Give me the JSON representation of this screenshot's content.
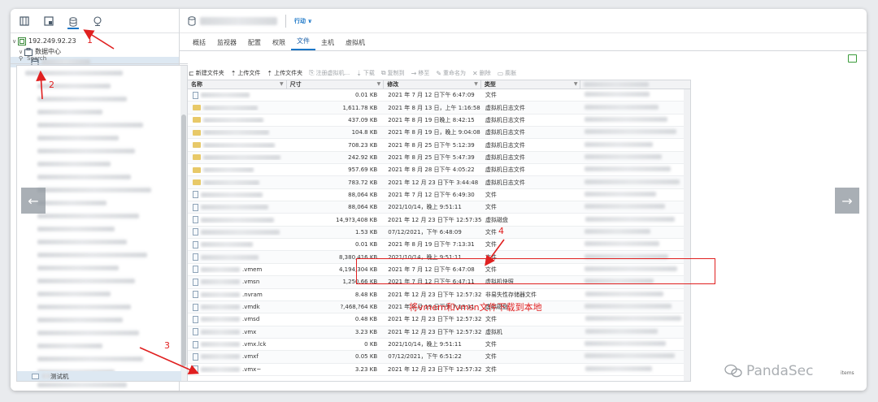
{
  "sidebar": {
    "tree": {
      "host": "192.249.92.23",
      "datacenter": "数据中心"
    }
  },
  "header": {
    "actions_label": "行动 ∨"
  },
  "tabs": [
    {
      "label": "概括"
    },
    {
      "label": "监视器"
    },
    {
      "label": "配置"
    },
    {
      "label": "权限"
    },
    {
      "label": "文件",
      "active": true
    },
    {
      "label": "主机"
    },
    {
      "label": "虚拟机"
    }
  ],
  "search": {
    "placeholder": "Search"
  },
  "folder_pane": {
    "selected_label": "测试机"
  },
  "toolbar": {
    "new_folder": "新建文件夹",
    "upload_file": "上传文件",
    "upload_folder": "上传文件夹",
    "register_vm": "注册虚拟机...",
    "download": "下载",
    "copy_to": "复制到",
    "move_to": "移至",
    "rename": "重命名为",
    "delete": "删除",
    "inflate": "膨胀"
  },
  "table": {
    "columns": [
      "名称",
      "尺寸",
      "修改",
      "类型"
    ],
    "rows": [
      {
        "name": "",
        "size": "0.01 KB",
        "modified": "2021 年 7 月 12 日下午 6:47:09",
        "type": "文件"
      },
      {
        "name": "",
        "size": "1,611.78 KB",
        "modified": "2021 年 8 月 13 日，上午 1:16:58",
        "type": "虚拟机日志文件"
      },
      {
        "name": "",
        "size": "437.09 KB",
        "modified": "2021 年 8 月 19 日晚上 8:42:15",
        "type": "虚拟机日志文件"
      },
      {
        "name": "",
        "size": "104.8 KB",
        "modified": "2021 年 8 月 19 日，晚上 9:04:08",
        "type": "虚拟机日志文件"
      },
      {
        "name": "",
        "size": "708.23 KB",
        "modified": "2021 年 8 月 25 日下午 5:12:39",
        "type": "虚拟机日志文件"
      },
      {
        "name": "",
        "size": "242.92 KB",
        "modified": "2021 年 8 月 25 日下午 5:47:39",
        "type": "虚拟机日志文件"
      },
      {
        "name": "",
        "size": "957.69 KB",
        "modified": "2021 年 8 月 28 日下午 4:05:22",
        "type": "虚拟机日志文件"
      },
      {
        "name": "",
        "size": "783.72 KB",
        "modified": "2021 年 12 月 23 日下午 3:44:48",
        "type": "虚拟机日志文件"
      },
      {
        "name": "",
        "size": "88,064 KB",
        "modified": "2021 年 7 月 12 日下午 6:49:30",
        "type": "文件"
      },
      {
        "name": "",
        "size": "88,064 KB",
        "modified": "2021/10/14，晚上 9:51:11",
        "type": "文件"
      },
      {
        "name": "",
        "size": "14,9?3,408 KB",
        "modified": "2021 年 12 月 23 日下午 12:57:35",
        "type": "虚拟磁盘"
      },
      {
        "name": "",
        "size": "1.53 KB",
        "modified": "07/12/2021，下午 6:48:09",
        "type": "文件"
      },
      {
        "name": "",
        "size": "0.01 KB",
        "modified": "2021 年 8 月 19 日下午 7:13:31",
        "type": "文件"
      },
      {
        "name": "",
        "size": "8,380,416 KB",
        "modified": "2021/10/14，晚上 9:51:11",
        "type": "文件"
      },
      {
        "name": ".vmem",
        "size": "4,194,304 KB",
        "modified": "2021 年 7 月 12 日下午 6:47:08",
        "type": "文件"
      },
      {
        "name": ".vmsn",
        "size": "1,250.66 KB",
        "modified": "2021 年 7 月 12 日下午 6:47:11",
        "type": "虚拟机快照"
      },
      {
        "name": ".nvram",
        "size": "8.48 KB",
        "modified": "2021 年 12 月 23 日下午 12:57:32",
        "type": "非易失性存储器文件"
      },
      {
        "name": ".vmdk",
        "size": "?,468,?64 KB",
        "modified": "2021 年 8 月 19 日下午 7:13:11",
        "type": "虚拟磁盘"
      },
      {
        "name": ".vmsd",
        "size": "0.48 KB",
        "modified": "2021 年 12 月 23 日下午 12:57:32",
        "type": "文件"
      },
      {
        "name": ".vmx",
        "size": "3.23 KB",
        "modified": "2021 年 12 月 23 日下午 12:57:32",
        "type": "虚拟机"
      },
      {
        "name": ".vmx.lck",
        "size": "0 KB",
        "modified": "2021/10/14，晚上 9:51:11",
        "type": "文件"
      },
      {
        "name": ".vmxf",
        "size": "0.05 KB",
        "modified": "07/12/2021，下午 6:51:22",
        "type": "文件"
      },
      {
        "name": ".vmx~",
        "size": "3.23 KB",
        "modified": "2021 年 12 月 23 日下午 12:57:32",
        "type": "文件"
      }
    ]
  },
  "annotations": {
    "labels": [
      "1",
      "2",
      "3",
      "4"
    ],
    "note": "将vmem和vmsn文件下载到本地",
    "color": "#e02020"
  },
  "watermark": "PandaSec",
  "footer": {
    "items_label": "items"
  },
  "colors": {
    "accent": "#1a76c7",
    "selection": "#dde8f2"
  },
  "icons": {
    "left_tabs": [
      "hosts-clusters-icon",
      "vms-templates-icon",
      "storage-icon",
      "networking-icon"
    ]
  }
}
